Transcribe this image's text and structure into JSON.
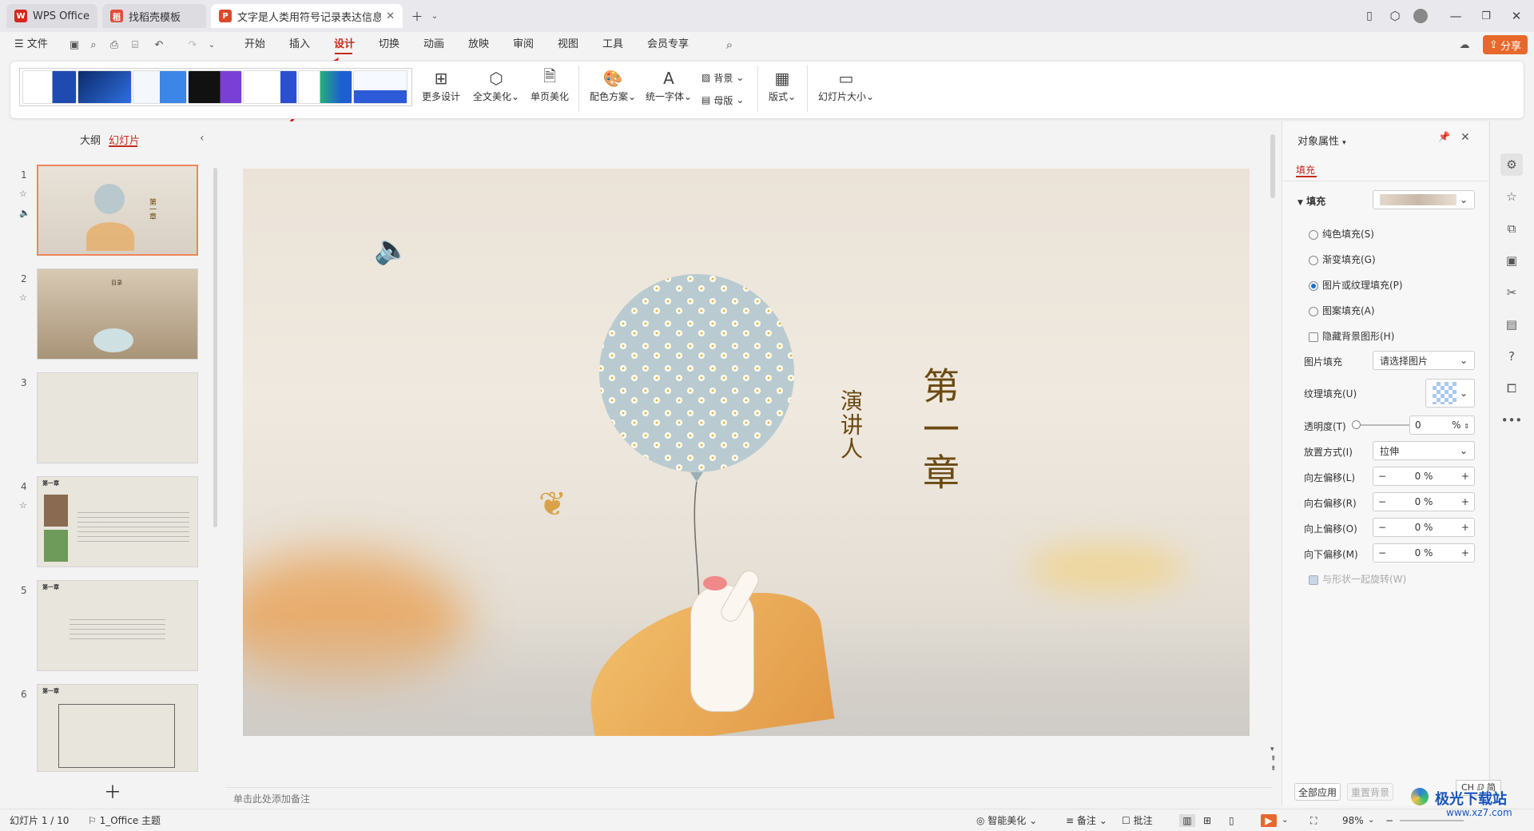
{
  "tabs": [
    {
      "label": "WPS Office"
    },
    {
      "label": "找稻壳模板"
    },
    {
      "label": "文字是人类用符号记录表达信息以"
    }
  ],
  "menu": {
    "file": "文件",
    "items": [
      "开始",
      "插入",
      "设计",
      "切换",
      "动画",
      "放映",
      "审阅",
      "视图",
      "工具",
      "会员专享"
    ],
    "share": "分享"
  },
  "ribbon": {
    "more_design": "更多设计",
    "full_beautify": "全文美化",
    "single_beautify": "单页美化",
    "color_scheme": "配色方案",
    "unify_font": "统一字体",
    "background": "背景",
    "master": "母版",
    "layout": "版式",
    "slide_size": "幻灯片大小"
  },
  "left_pane": {
    "tab_outline": "大纲",
    "tab_slides": "幻灯片",
    "slide_numbers": [
      "1",
      "2",
      "3",
      "4",
      "5",
      "6"
    ],
    "thumb_title_chapter": "第一章",
    "thumb2_title": "目录"
  },
  "slide": {
    "title": "第一章",
    "speaker": "演讲人"
  },
  "notes_placeholder": "单击此处添加备注",
  "right_pane": {
    "title": "对象属性",
    "tab_fill": "填充",
    "section_fill": "填充",
    "opt_solid": "纯色填充(S)",
    "opt_gradient": "渐变填充(G)",
    "opt_picture": "图片或纹理填充(P)",
    "opt_pattern": "图案填充(A)",
    "opt_hide_bg": "隐藏背景图形(H)",
    "pic_fill_label": "图片填充",
    "pic_fill_value": "请选择图片",
    "texture_label": "纹理填充(U)",
    "transparency_label": "透明度(T)",
    "transparency_value": "0",
    "transparency_unit": "%",
    "placement_label": "放置方式(I)",
    "placement_value": "拉伸",
    "offset_left_label": "向左偏移(L)",
    "offset_right_label": "向右偏移(R)",
    "offset_up_label": "向上偏移(O)",
    "offset_down_label": "向下偏移(M)",
    "offset_value": "0 %",
    "rotate_with_shape": "与形状一起旋转(W)",
    "apply_all": "全部应用",
    "reset_bg": "重置背景"
  },
  "status": {
    "slide_info": "幻灯片 1 / 10",
    "theme": "1_Office 主题",
    "smart_beautify": "智能美化",
    "notes": "备注",
    "comments": "批注",
    "zoom": "98%",
    "ime": "CH ⅅ 简"
  },
  "watermark": {
    "site": "极光下载站",
    "url": "www.xz7.com"
  },
  "colors": {
    "accent_red": "#c42b1c",
    "share_orange": "#e8682c",
    "slide_title_brown": "#6b4a12"
  }
}
